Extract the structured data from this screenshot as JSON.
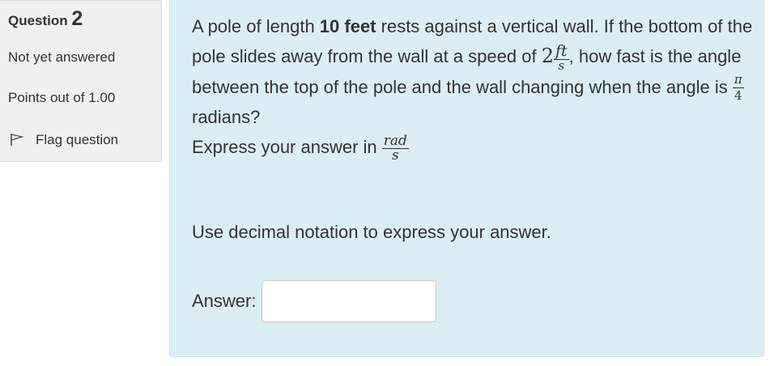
{
  "info": {
    "question_label": "Question",
    "question_number": "2",
    "state": "Not yet answered",
    "grade": "Points out of 1.00",
    "flag_label": "Flag question",
    "flag_icon": "flag-icon"
  },
  "question": {
    "text_1": "A pole of length ",
    "bold_1": "10 feet",
    "text_2": " rests against a vertical wall. If the bottom of the pole slides away from the wall at a speed of ",
    "speed_value": "2",
    "speed_unit_num": "ft",
    "speed_unit_den": "s",
    "text_3": ", how fast is the angle between the top of the pole and the wall changing when the angle is ",
    "angle_num": "π",
    "angle_den": "4",
    "text_4": " radians?",
    "text_5": "Express your answer in ",
    "unit_num": "rad",
    "unit_den": "s"
  },
  "instruction": "Use decimal notation to express your answer.",
  "answer": {
    "label": "Answer:",
    "value": ""
  },
  "colors": {
    "content_bg": "#dbeef6",
    "info_bg": "#f0f0f0",
    "text": "#333333"
  }
}
